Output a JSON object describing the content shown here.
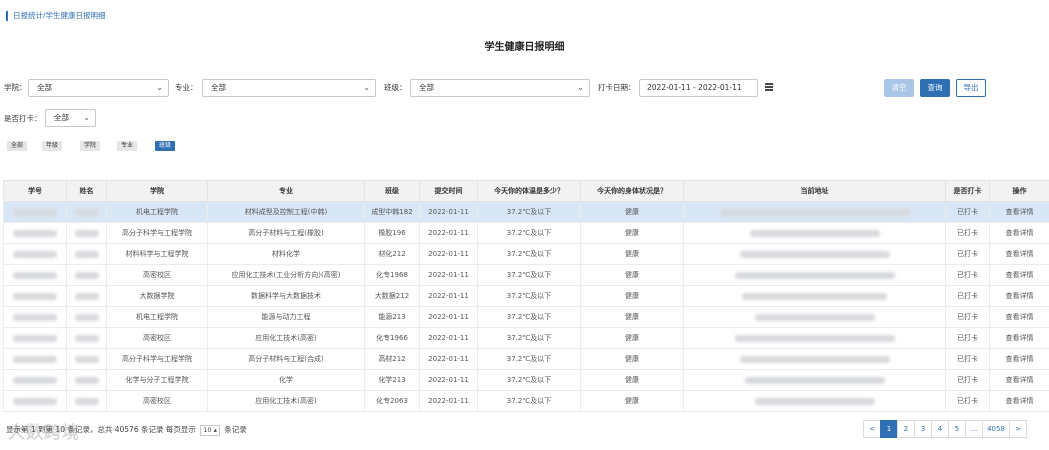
{
  "breadcrumb": "日报统计/学生健康日报明细",
  "page_title": "学生健康日报明细",
  "filters": {
    "college_label": "学院：",
    "college_value": "全部",
    "major_label": "专业：",
    "major_value": "全部",
    "class_label": "班级：",
    "class_value": "全部",
    "date_label": "打卡日期：",
    "date_value": "2022-01-11 - 2022-01-11",
    "checked_label": "是否打卡：",
    "checked_value": "全部"
  },
  "buttons": {
    "clear": "清空",
    "query": "查询",
    "export": "导出"
  },
  "chips": [
    "全部",
    "年级",
    "学院",
    "专业",
    "班级"
  ],
  "table": {
    "headers": [
      "学号",
      "姓名",
      "学院",
      "专业",
      "班级",
      "提交时间",
      "今天你的体温是多少？",
      "今天你的身体状况是？",
      "当前地址",
      "是否打卡",
      "操作"
    ],
    "rows": [
      {
        "college": "机电工程学院",
        "major": "材料成型及控制工程(中韩)",
        "class": "成型中韩182",
        "time": "2022-01-11",
        "temp": "37.2℃及以下",
        "health": "健康",
        "status": "已打卡",
        "action": "查看详情"
      },
      {
        "college": "高分子科学与工程学院",
        "major": "高分子材料与工程(橡胶)",
        "class": "橡胶196",
        "time": "2022-01-11",
        "temp": "37.2℃及以下",
        "health": "健康",
        "status": "已打卡",
        "action": "查看详情"
      },
      {
        "college": "材料科学与工程学院",
        "major": "材料化学",
        "class": "材化212",
        "time": "2022-01-11",
        "temp": "37.2℃及以下",
        "health": "健康",
        "status": "已打卡",
        "action": "查看详情"
      },
      {
        "college": "高密校区",
        "major": "应用化工技术(工业分析方向)(高密)",
        "class": "化专1968",
        "time": "2022-01-11",
        "temp": "37.2℃及以下",
        "health": "健康",
        "status": "已打卡",
        "action": "查看详情"
      },
      {
        "college": "大数据学院",
        "major": "数据科学与大数据技术",
        "class": "大数据212",
        "time": "2022-01-11",
        "temp": "37.2℃及以下",
        "health": "健康",
        "status": "已打卡",
        "action": "查看详情"
      },
      {
        "college": "机电工程学院",
        "major": "能源与动力工程",
        "class": "能源213",
        "time": "2022-01-11",
        "temp": "37.2℃及以下",
        "health": "健康",
        "status": "已打卡",
        "action": "查看详情"
      },
      {
        "college": "高密校区",
        "major": "应用化工技术(高密)",
        "class": "化专1966",
        "time": "2022-01-11",
        "temp": "37.2℃及以下",
        "health": "健康",
        "status": "已打卡",
        "action": "查看详情"
      },
      {
        "college": "高分子科学与工程学院",
        "major": "高分子材料与工程(合成)",
        "class": "高材212",
        "time": "2022-01-11",
        "temp": "37.2℃及以下",
        "health": "健康",
        "status": "已打卡",
        "action": "查看详情"
      },
      {
        "college": "化学与分子工程学院",
        "major": "化学",
        "class": "化学213",
        "time": "2022-01-11",
        "temp": "37.2℃及以下",
        "health": "健康",
        "status": "已打卡",
        "action": "查看详情"
      },
      {
        "college": "高密校区",
        "major": "应用化工技术(高密)",
        "class": "化专2063",
        "time": "2022-01-11",
        "temp": "37.2℃及以下",
        "health": "健康",
        "status": "已打卡",
        "action": "查看详情"
      }
    ]
  },
  "footer": {
    "info_prefix": "显示第 1 到第 10 条记录，总共 40576 条记录 每页显示",
    "page_size": "10",
    "info_suffix": "条记录",
    "watermark": "大数跨境"
  },
  "pager": {
    "prev": "<",
    "pages": [
      "1",
      "2",
      "3",
      "4",
      "5"
    ],
    "ellipsis": "...",
    "last": "4058",
    "next": ">"
  },
  "colors": {
    "primary": "#2f6fb4",
    "selected_row": "#d8e7f6"
  }
}
